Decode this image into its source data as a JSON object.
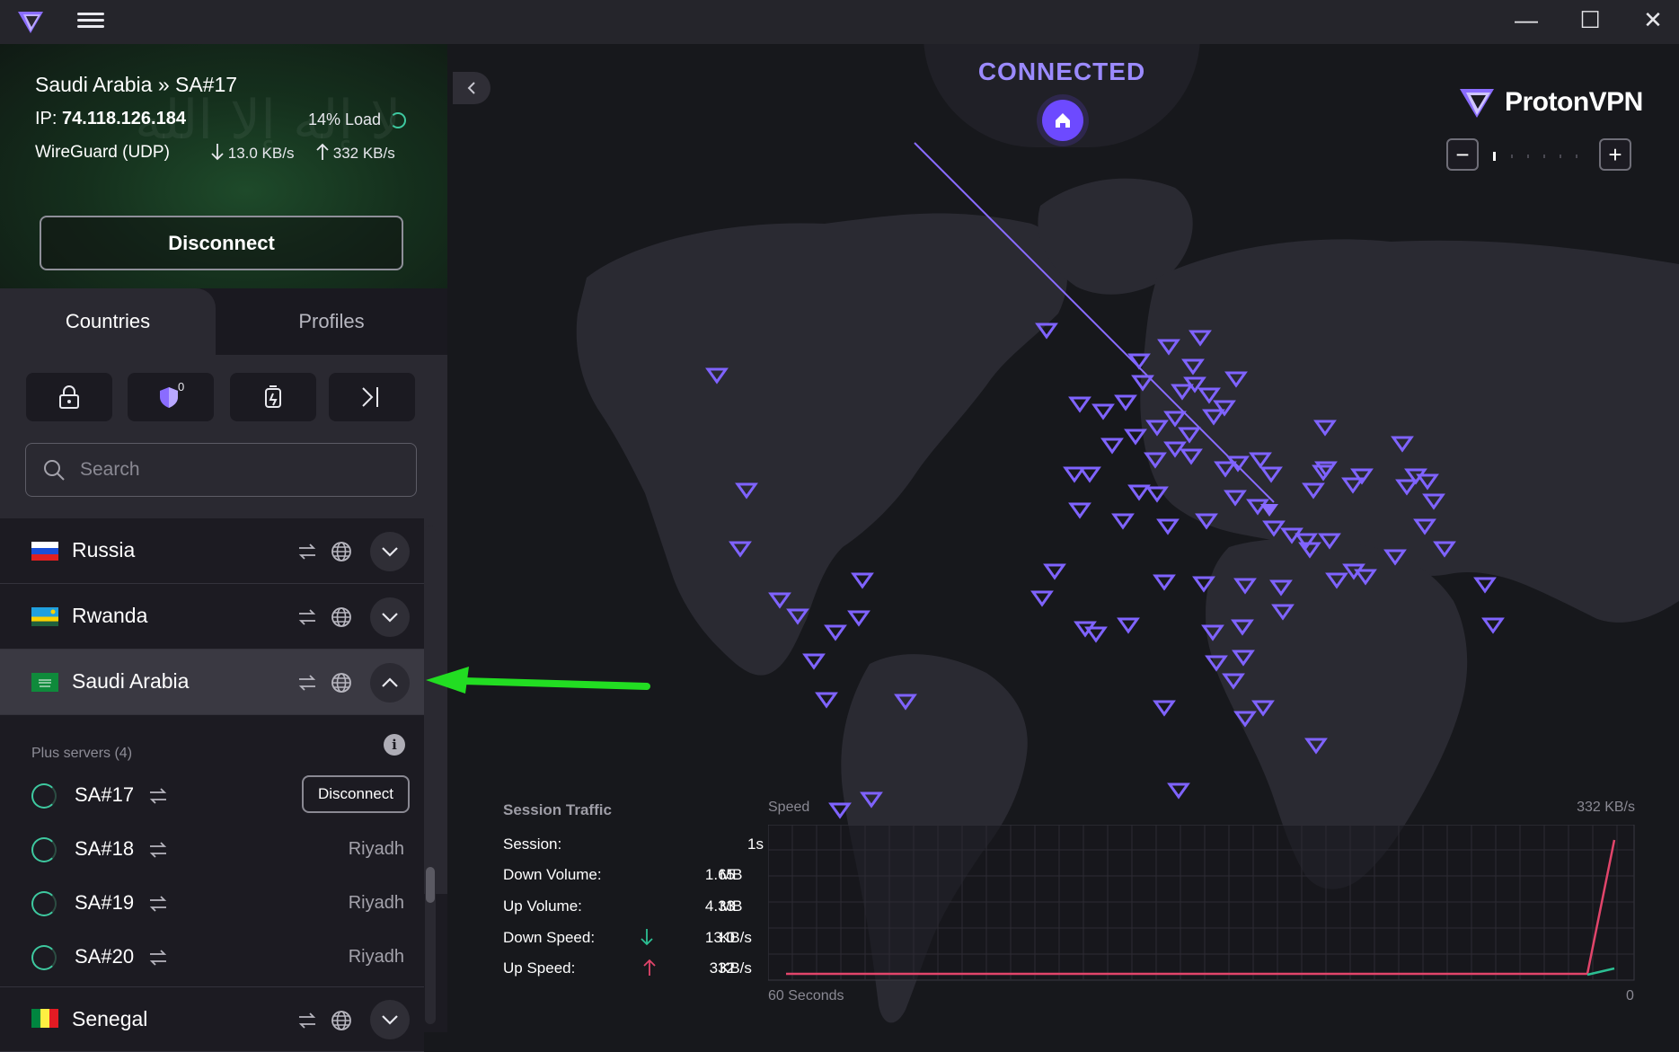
{
  "titlebar": {
    "minimize": "—",
    "maximize": "☐",
    "close": "✕"
  },
  "connection": {
    "location": "Saudi Arabia » SA#17",
    "ip_label": "IP:",
    "ip_value": "74.118.126.184",
    "load": "14% Load",
    "protocol": "WireGuard (UDP)",
    "down_speed": "13.0 KB/s",
    "up_speed": "332 KB/s",
    "disconnect_label": "Disconnect"
  },
  "tabs": [
    "Countries",
    "Profiles"
  ],
  "filters": {
    "netshield_count": "0"
  },
  "search": {
    "placeholder": "Search"
  },
  "countries": [
    {
      "name": "Russia",
      "expanded": false
    },
    {
      "name": "Rwanda",
      "expanded": false
    },
    {
      "name": "Saudi Arabia",
      "expanded": true
    },
    {
      "name": "Senegal",
      "expanded": false
    }
  ],
  "plus_servers": {
    "header": "Plus servers (4)",
    "info": "i",
    "servers": [
      {
        "name": "SA#17",
        "action": "Disconnect"
      },
      {
        "name": "SA#18",
        "city": "Riyadh"
      },
      {
        "name": "SA#19",
        "city": "Riyadh"
      },
      {
        "name": "SA#20",
        "city": "Riyadh"
      }
    ]
  },
  "map": {
    "status": "CONNECTED",
    "brand": "ProtonVPN",
    "zoom_out": "−",
    "zoom_in": "+"
  },
  "session_traffic": {
    "title": "Session Traffic",
    "rows": [
      {
        "label": "Session:",
        "value": "1s",
        "unit": ""
      },
      {
        "label": "Down Volume:",
        "value": "1.65",
        "unit": "MB"
      },
      {
        "label": "Up Volume:",
        "value": "4.33",
        "unit": "MB"
      },
      {
        "label": "Down Speed:",
        "value": "13.0",
        "unit": "KB/s"
      },
      {
        "label": "Up Speed:",
        "value": "332",
        "unit": "KB/s"
      }
    ]
  },
  "speed_graph": {
    "label": "Speed",
    "max_label": "332  KB/s",
    "x_left": "60 Seconds",
    "x_right": "0"
  },
  "colors": {
    "accent": "#6d4aff",
    "status": "#9b8aff",
    "green_ring": "#3ec9a0",
    "download_line": "#e2456b",
    "upload_line": "#2cbf93",
    "arrow_annotation": "#22dd22"
  }
}
